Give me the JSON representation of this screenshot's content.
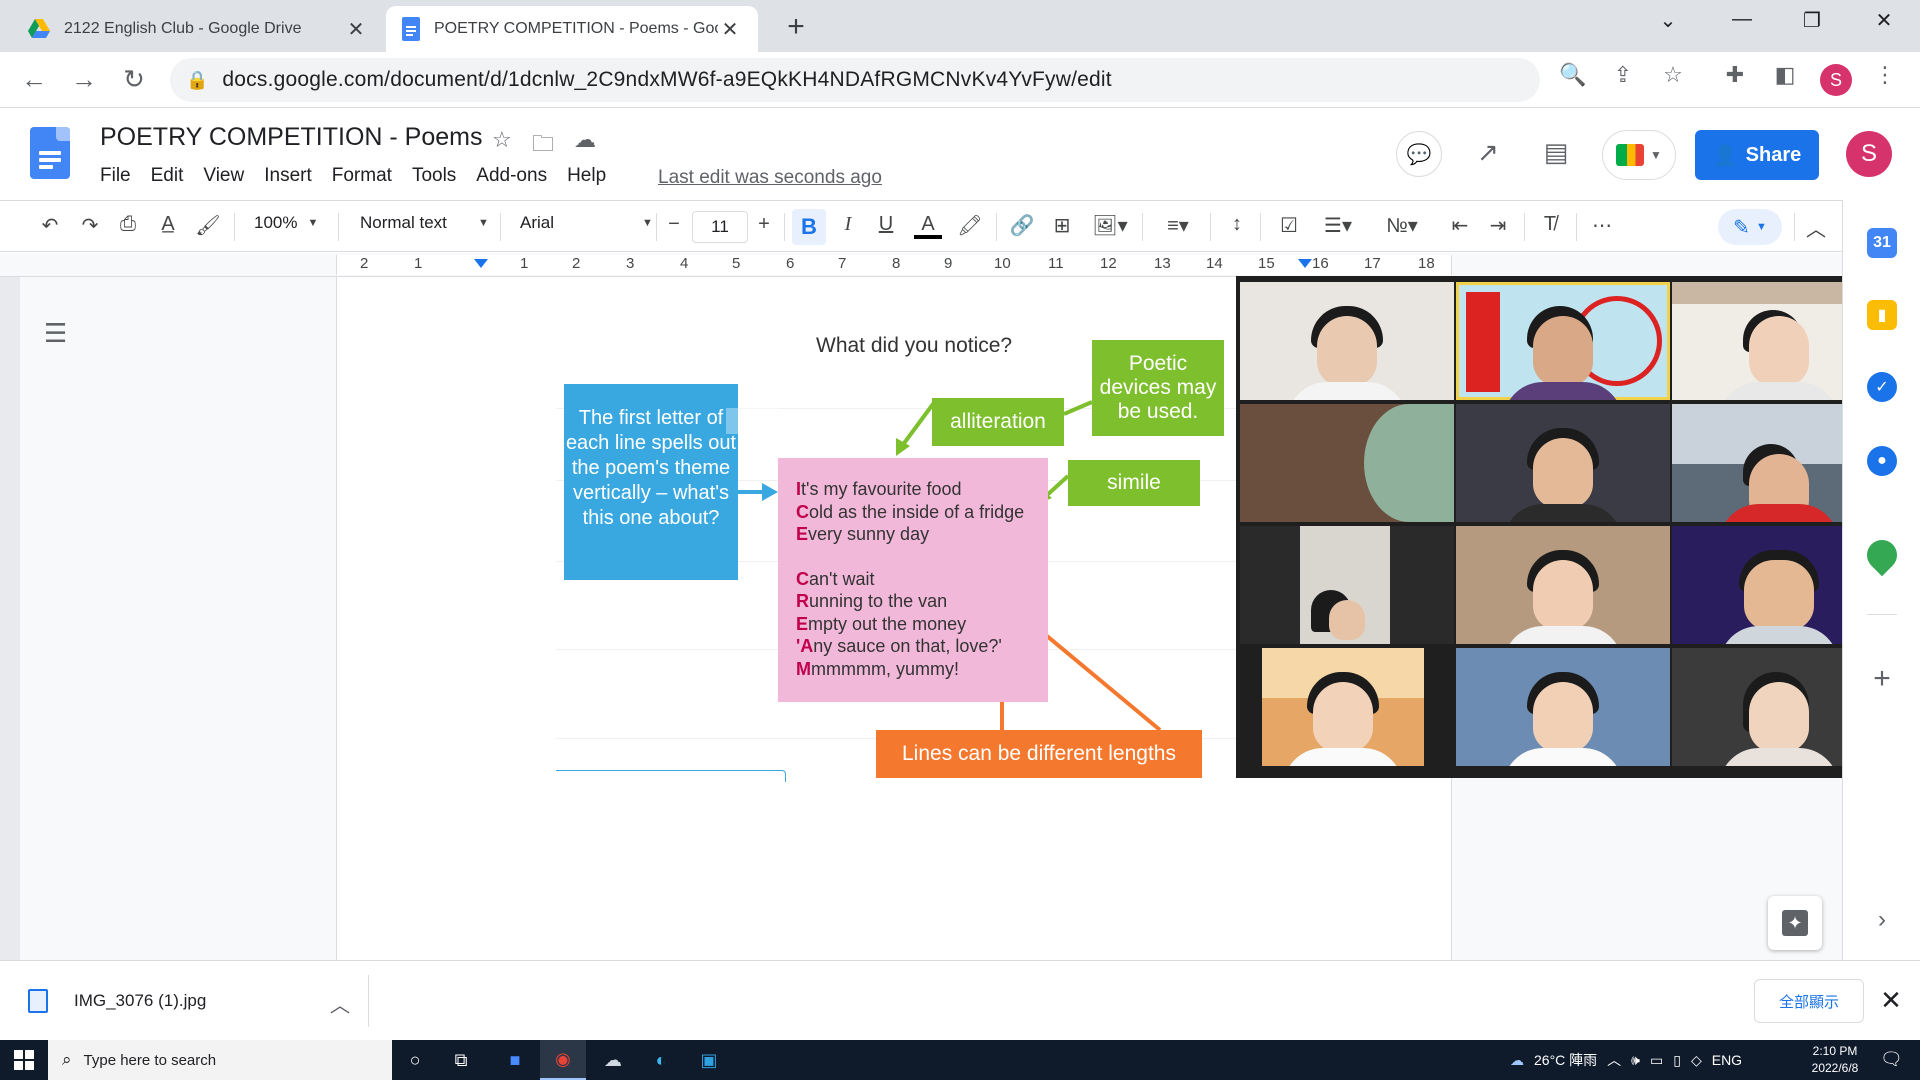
{
  "browser": {
    "tabs": [
      {
        "title": "2122 English Club - Google Drive",
        "icon": "google-drive-icon"
      },
      {
        "title": "POETRY COMPETITION - Poems - Goog",
        "icon": "google-docs-icon"
      }
    ],
    "url": "docs.google.com/document/d/1dcnlw_2C9ndxMW6f-a9EQkKH4NDAfRGMCNvKv4YvFyw/edit",
    "profile_initial": "S"
  },
  "docs": {
    "title": "POETRY COMPETITION - Poems",
    "menu": [
      "File",
      "Edit",
      "View",
      "Insert",
      "Format",
      "Tools",
      "Add-ons",
      "Help"
    ],
    "last_edit": "Last edit was seconds ago",
    "share_label": "Share",
    "avatar_initial": "S"
  },
  "toolbar": {
    "zoom": "100%",
    "style": "Normal text",
    "font": "Arial",
    "font_size": "11",
    "bold": "B",
    "italic": "I",
    "underline": "U",
    "text_color": "A"
  },
  "ruler": {
    "marks": [
      "2",
      "1",
      "1",
      "2",
      "3",
      "4",
      "5",
      "6",
      "7",
      "8",
      "9",
      "10",
      "11",
      "12",
      "13",
      "14",
      "15",
      "16",
      "17",
      "18"
    ]
  },
  "slide": {
    "heading": "What did you notice?",
    "blue_note": "The first letter of each line spells out the poem's theme vertically – what's this one about?",
    "poem_lines_1": [
      {
        "first": "I",
        "rest": "t's my favourite food"
      },
      {
        "first": "C",
        "rest": "old as the inside of a fridge"
      },
      {
        "first": "E",
        "rest": "very sunny day"
      }
    ],
    "poem_lines_2": [
      {
        "first": "C",
        "rest": "an't wait"
      },
      {
        "first": "R",
        "rest": "unning to the van"
      },
      {
        "first": "E",
        "rest": "mpty out the money"
      },
      {
        "first": "'A",
        "rest": "ny sauce on that, love?'"
      },
      {
        "first": "M",
        "rest": "mmmmm, yummy!"
      }
    ],
    "alliteration": "alliteration",
    "poetic_devices": "Poetic devices may be used.",
    "simile": "simile",
    "lines_note": "Lines can be different lengths"
  },
  "download": {
    "file_name": "IMG_3076 (1).jpg",
    "show_all": "全部顯示"
  },
  "taskbar": {
    "search_placeholder": "Type here to search",
    "weather": "26°C 陣雨",
    "lang": "ENG",
    "time": "2:10 PM",
    "date": "2022/6/8"
  },
  "colors": {
    "accent": "#1a73e8",
    "blue_box": "#3aa8e0",
    "pink_box": "#f2b8d9",
    "green_box": "#7dbf2c",
    "orange_box": "#f4792f",
    "taskbar": "#0f1a2b"
  },
  "video_call": {
    "participant_count": 12,
    "speaking_tile": 2
  }
}
